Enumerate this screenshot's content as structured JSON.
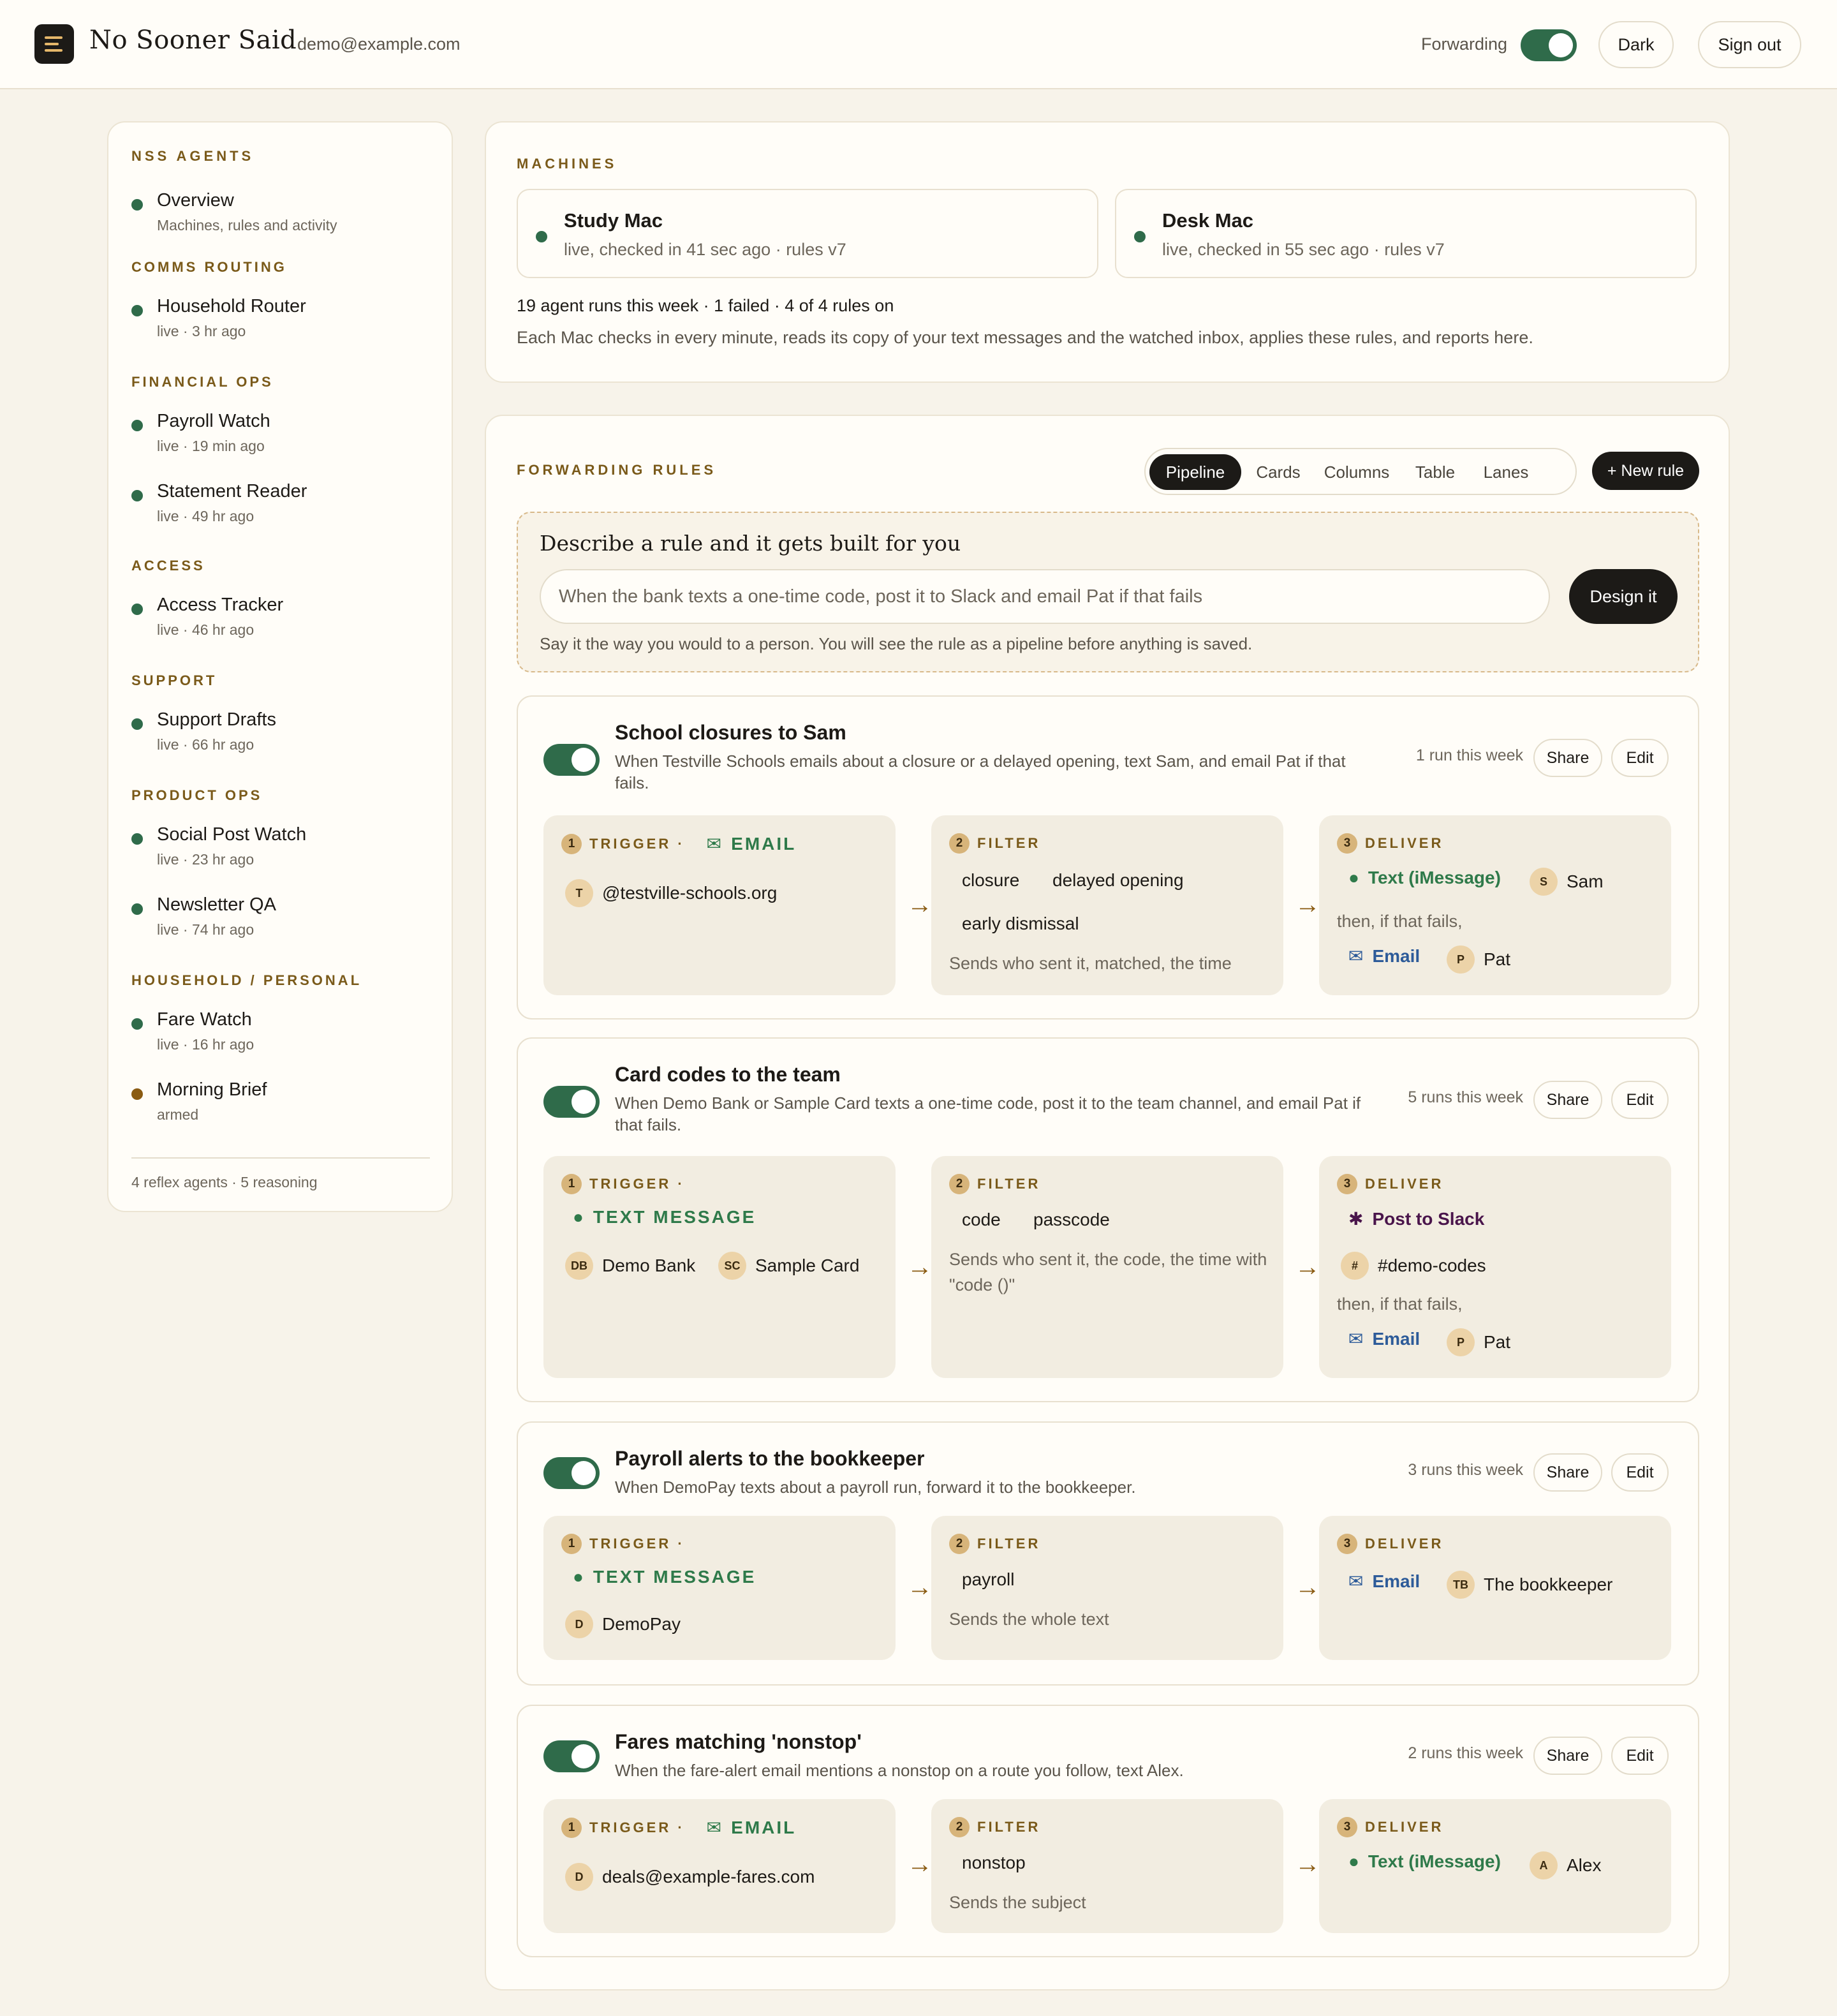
{
  "header": {
    "brand": "No Sooner Said",
    "account": "demo@example.com",
    "forwarding_label": "Forwarding",
    "dark_label": "Dark",
    "signout_label": "Sign out"
  },
  "sidebar": {
    "title": "NSS AGENTS",
    "overview": {
      "name": "Overview",
      "sub": "Machines, rules and activity"
    },
    "sections": [
      {
        "label": "COMMS ROUTING",
        "items": [
          {
            "name": "Household Router",
            "sub": "live · 3 hr ago"
          }
        ]
      },
      {
        "label": "FINANCIAL OPS",
        "items": [
          {
            "name": "Payroll Watch",
            "sub": "live · 19 min ago"
          },
          {
            "name": "Statement Reader",
            "sub": "live · 49 hr ago"
          }
        ]
      },
      {
        "label": "ACCESS",
        "items": [
          {
            "name": "Access Tracker",
            "sub": "live · 46 hr ago"
          }
        ]
      },
      {
        "label": "SUPPORT",
        "items": [
          {
            "name": "Support Drafts",
            "sub": "live · 66 hr ago"
          }
        ]
      },
      {
        "label": "PRODUCT OPS",
        "items": [
          {
            "name": "Social Post Watch",
            "sub": "live · 23 hr ago"
          },
          {
            "name": "Newsletter QA",
            "sub": "live · 74 hr ago"
          }
        ]
      },
      {
        "label": "HOUSEHOLD / PERSONAL",
        "items": [
          {
            "name": "Fare Watch",
            "sub": "live · 16 hr ago"
          },
          {
            "name": "Morning Brief",
            "sub": "armed"
          }
        ]
      }
    ],
    "footer": "4 reflex agents · 5 reasoning"
  },
  "machines": {
    "title": "MACHINES",
    "list": [
      {
        "name": "Study Mac",
        "status": "live, checked in 41 sec ago · rules v7"
      },
      {
        "name": "Desk Mac",
        "status": "live, checked in 55 sec ago · rules v7"
      }
    ],
    "summary": "19 agent runs this week · 1 failed · 4 of 4 rules on",
    "explain": "Each Mac checks in every minute, reads its copy of your text messages and the watched inbox, applies these rules, and reports here."
  },
  "rules": {
    "title": "FORWARDING RULES",
    "tabs": [
      "Pipeline",
      "Cards",
      "Columns",
      "Table",
      "Lanes"
    ],
    "new_rule": "+ New rule",
    "designer": {
      "heading": "Describe a rule and it gets built for you",
      "placeholder": "When the bank texts a one-time code, post it to Slack and email Pat if that fails",
      "button": "Design it",
      "hint": "Say it the way you would to a person. You will see the rule as a pipeline before anything is saved."
    },
    "share": "Share",
    "edit": "Edit",
    "trigger_label": "TRIGGER ·",
    "filter_label": "FILTER",
    "deliver_label": "DELIVER",
    "email_channel": "EMAIL",
    "text_channel": "TEXT MESSAGE",
    "then_fails": "then, if that fails,",
    "items": [
      {
        "title": "School closures to Sam",
        "desc": "When Testville Schools emails about a closure or a delayed opening, text Sam, and email Pat if that fails.",
        "runs": "1 run this week",
        "trigger_sender": "@testville-schools.org",
        "trigger_avatar": "T",
        "keywords": [
          "closure",
          "delayed opening",
          "early dismissal"
        ],
        "filter_note": "Sends who sent it, matched, the time",
        "deliver_primary": "Text (iMessage)",
        "deliver_primary_to": "Sam",
        "deliver_primary_avatar": "S",
        "deliver_fallback": "Email",
        "deliver_fallback_to": "Pat",
        "deliver_fallback_avatar": "P"
      },
      {
        "title": "Card codes to the team",
        "desc": "When Demo Bank or Sample Card texts a one-time code, post it to the team channel, and email Pat if that fails.",
        "runs": "5 runs this week",
        "senders": [
          {
            "avatar": "DB",
            "name": "Demo Bank"
          },
          {
            "avatar": "SC",
            "name": "Sample Card"
          }
        ],
        "keywords": [
          "code",
          "passcode"
        ],
        "filter_note": "Sends who sent it, the code, the time with \"code ()\"",
        "deliver_primary": "Post to Slack",
        "channel_avatar": "#",
        "channel": "#demo-codes",
        "deliver_fallback": "Email",
        "deliver_fallback_to": "Pat",
        "deliver_fallback_avatar": "P"
      },
      {
        "title": "Payroll alerts to the bookkeeper",
        "desc": "When DemoPay texts about a payroll run, forward it to the bookkeeper.",
        "runs": "3 runs this week",
        "trigger_sender": "DemoPay",
        "trigger_avatar": "D",
        "keywords": [
          "payroll"
        ],
        "filter_note": "Sends the whole text",
        "deliver_primary": "Email",
        "deliver_primary_to": "The bookkeeper",
        "deliver_primary_avatar": "TB"
      },
      {
        "title": "Fares matching 'nonstop'",
        "desc": "When the fare-alert email mentions a nonstop on a route you follow, text Alex.",
        "runs": "2 runs this week",
        "trigger_sender": "deals@example-fares.com",
        "trigger_avatar": "D",
        "keywords": [
          "nonstop"
        ],
        "filter_note": "Sends the subject",
        "deliver_primary": "Text (iMessage)",
        "deliver_primary_to": "Alex",
        "deliver_primary_avatar": "A"
      }
    ]
  },
  "colors": {
    "accent_green": "#2f6b4a",
    "label_brown": "#7a5a1a",
    "email_blue": "#2d5b99",
    "background": "#f7f3ea"
  }
}
